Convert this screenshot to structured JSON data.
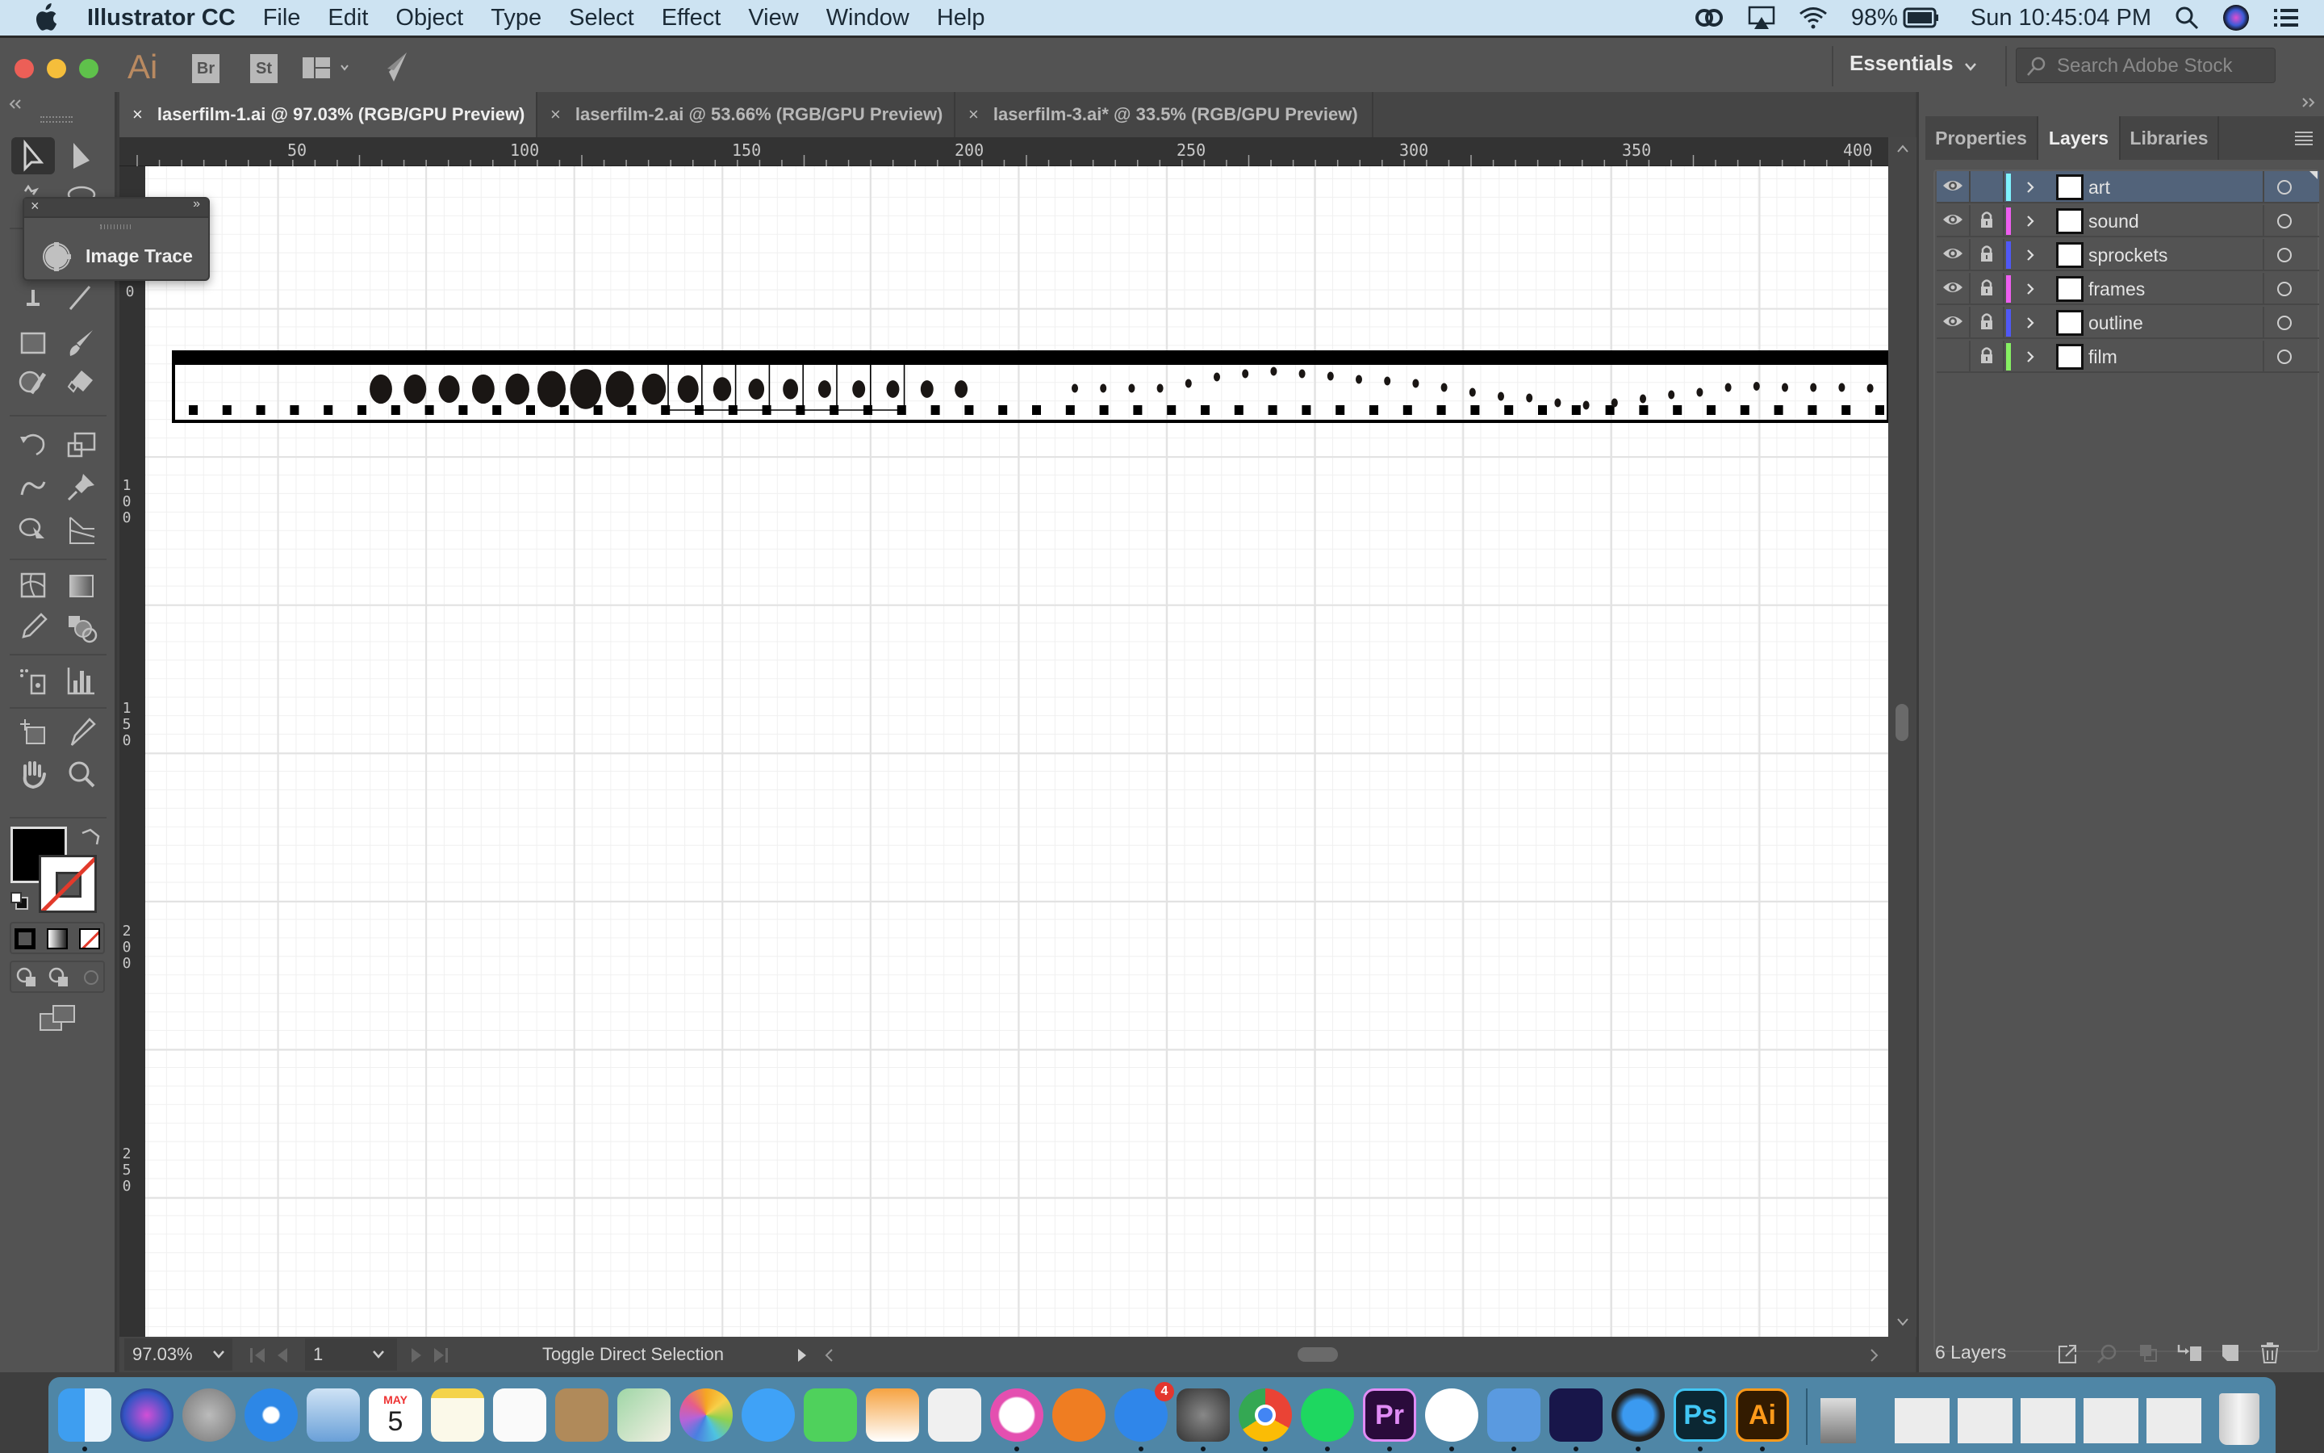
{
  "menubar": {
    "app_name": "Illustrator CC",
    "items": [
      "File",
      "Edit",
      "Object",
      "Type",
      "Select",
      "Effect",
      "View",
      "Window",
      "Help"
    ],
    "battery": "98%",
    "clock": "Sun 10:45:04 PM"
  },
  "appbar": {
    "logo": "Ai",
    "bridge": "Br",
    "stock": "St",
    "workspace": "Essentials",
    "search_placeholder": "Search Adobe Stock"
  },
  "tabs": [
    {
      "close": "×",
      "label": "laserfilm-1.ai @ 97.03% (RGB/GPU Preview)",
      "active": true
    },
    {
      "close": "×",
      "label": "laserfilm-2.ai @ 53.66% (RGB/GPU Preview)",
      "active": false
    },
    {
      "close": "×",
      "label": "laserfilm-3.ai* @ 33.5% (RGB/GPU Preview)",
      "active": false
    }
  ],
  "hruler": [
    "50",
    "100",
    "150",
    "200",
    "250",
    "300",
    "350",
    "400"
  ],
  "vruler": [
    "0",
    "100",
    "150",
    "200",
    "250"
  ],
  "image_trace_panel": {
    "close": "×",
    "expand": "»",
    "label": "Image Trace"
  },
  "statusbar": {
    "zoom": "97.03%",
    "artboard": "1",
    "tool_hint": "Toggle Direct Selection"
  },
  "right_panel": {
    "tabs": [
      "Properties",
      "Layers",
      "Libraries"
    ],
    "active_tab": "Layers",
    "layers": [
      {
        "name": "art",
        "visible": true,
        "locked": false,
        "color": "#7ef3ff",
        "selected": true
      },
      {
        "name": "sound",
        "visible": true,
        "locked": true,
        "color": "#ee5ef0",
        "selected": false
      },
      {
        "name": "sprockets",
        "visible": true,
        "locked": true,
        "color": "#5058f6",
        "selected": false
      },
      {
        "name": "frames",
        "visible": true,
        "locked": true,
        "color": "#ee5ef0",
        "selected": false
      },
      {
        "name": "outline",
        "visible": true,
        "locked": true,
        "color": "#5058f6",
        "selected": false
      },
      {
        "name": "film",
        "visible": false,
        "locked": true,
        "color": "#86f062",
        "selected": false
      }
    ],
    "layer_count": "6 Layers"
  },
  "dock": {
    "calendar_month": "MAY",
    "calendar_day": "5",
    "appstore_badge": "4",
    "apps": [
      "Finder",
      "Siri",
      "Launchpad",
      "Safari",
      "Mail",
      "Calendar",
      "Notes",
      "Reminders",
      "Contacts",
      "Maps",
      "Photos",
      "Messages",
      "FaceTime",
      "Pages",
      "Numbers",
      "iTunes",
      "iBooks",
      "App Store",
      "System Preferences",
      "Chrome",
      "Spotify",
      "Premiere",
      "Transmit",
      "Fiji",
      "Media Encoder",
      "QuickTime",
      "Photoshop",
      "Illustrator"
    ],
    "pr_label": "Pr",
    "ps_label": "Ps",
    "ai_label": "Ai"
  },
  "artwork": {
    "sound_dot_sizes": [
      0.55,
      0.55,
      0.5,
      0.55,
      0.6,
      0.75,
      0.85,
      0.75,
      0.6,
      0.5,
      0.4,
      0.32,
      0.3,
      0.22,
      0.22,
      0.22,
      0.22,
      0.22
    ],
    "sound_wave_levels": [
      0.5,
      0.5,
      0.5,
      0.5,
      0.62,
      0.78,
      0.86,
      0.92,
      0.86,
      0.8,
      0.72,
      0.68,
      0.62,
      0.52,
      0.4,
      0.3,
      0.26,
      0.14,
      0.08,
      0.14,
      0.24,
      0.34,
      0.4,
      0.52,
      0.55,
      0.52,
      0.52,
      0.52,
      0.5
    ]
  }
}
